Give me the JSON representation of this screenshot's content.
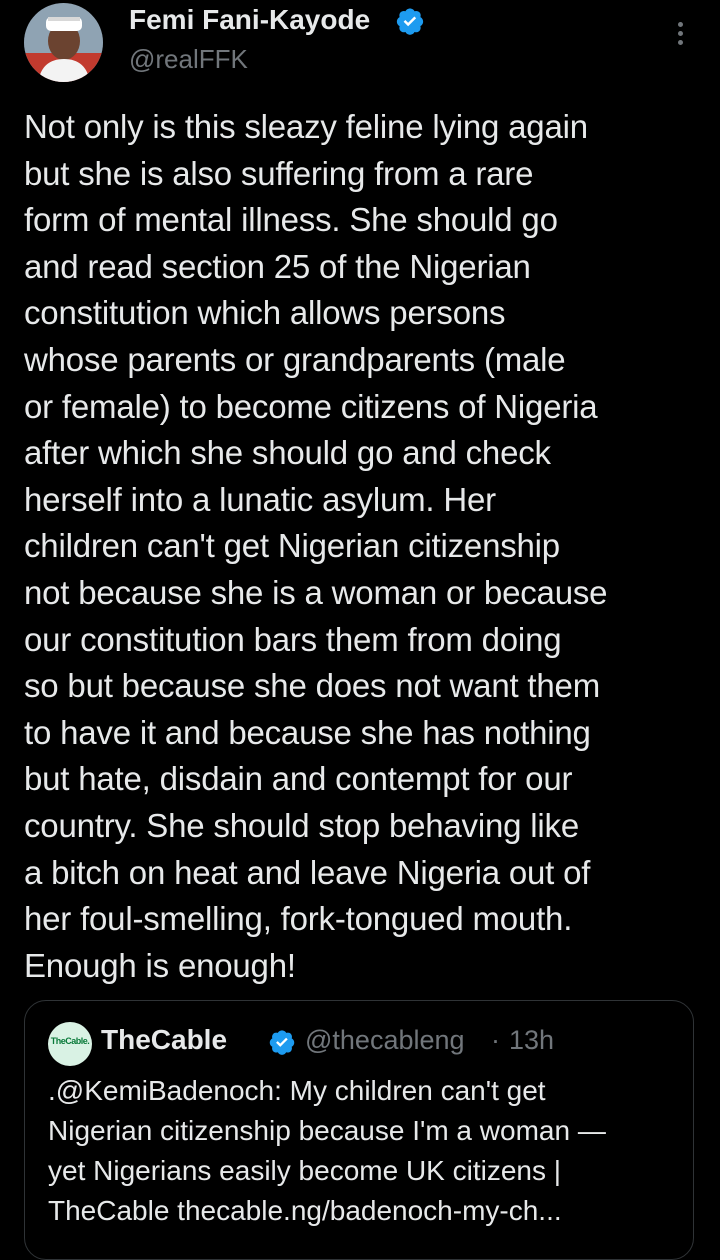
{
  "author": {
    "name": "Femi Fani-Kayode",
    "handle": "@realFFK",
    "verified": true,
    "avatar_icon": "profile-photo"
  },
  "tweet": {
    "text": "Not only is this sleazy feline lying again\nbut she is also suffering from a rare\nform of mental illness. She should go\nand read section 25 of the Nigerian\nconstitution which allows persons\nwhose parents or grandparents (male\nor female) to become citizens of Nigeria\nafter which she should go and check\nherself into a lunatic asylum. Her\nchildren can't get Nigerian citizenship\nnot because she is a woman or because\nour constitution bars them from doing\nso but because she does not want them\nto have it and because she has nothing\nbut hate, disdain and contempt for our\ncountry. She should stop behaving like\na bitch on heat and leave Nigeria out of\nher foul-smelling, fork-tongued mouth.\nEnough is enough!"
  },
  "quoted": {
    "logo_text": "TheCable.",
    "name": "TheCable",
    "handle": "@thecableng",
    "separator": "·",
    "time": "13h",
    "text": ".@KemiBadenoch: My children can't get\nNigerian citizenship because I'm a woman —\nyet Nigerians easily become UK citizens |\nTheCable thecable.ng/badenoch-my-ch..."
  },
  "colors": {
    "background": "#000000",
    "text": "#e7e9ea",
    "secondary": "#71767b",
    "verified": "#1d9bf0",
    "border": "#2f3336"
  },
  "icons": {
    "verified": "verified-badge-icon",
    "more": "more-options-icon"
  }
}
